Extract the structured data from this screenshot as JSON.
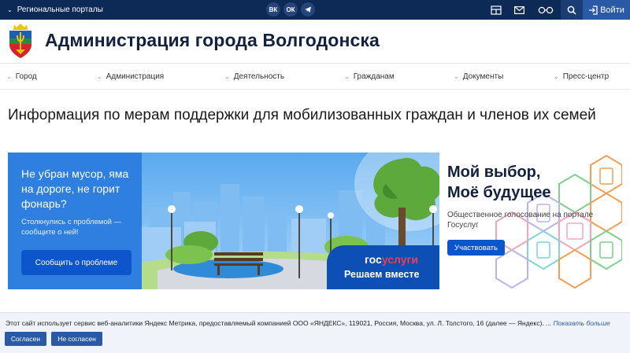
{
  "topbar": {
    "regional_label": "Региональные порталы",
    "socials": [
      "ВК",
      "ОК",
      "TG"
    ],
    "login_label": "Войти"
  },
  "header": {
    "title": "Администрация города Волгодонска"
  },
  "nav": {
    "items": [
      "Город",
      "Администрация",
      "Деятельность",
      "Гражданам",
      "Документы",
      "Пресс-центр"
    ]
  },
  "page": {
    "title": "Информация по мерам поддержки для мобилизованных граждан и членов их семей"
  },
  "banner": {
    "left_headline": "Не убран мусор, яма на дороге, не горит фонарь?",
    "left_sub": "Столкнулись с проблемой — сообщите о ней!",
    "left_button": "Сообщить о проблеме",
    "gos_logo_a": "гос",
    "gos_logo_b": "услуги",
    "gos_sub": "Решаем вместе",
    "right_headline_1": "Мой выбор,",
    "right_headline_2": "Моё будущее",
    "right_sub": "Общественное голосование на портале Госуслуг",
    "right_button": "Участвовать"
  },
  "cookie": {
    "text": "Этот сайт использует сервис веб-аналитики Яндекс Метрика, предоставляемый компанией ООО «ЯНДЕКС», 119021, Россия, Москва, ул. Л. Толстого, 16 (далее — Яндекс).",
    "more": "... Показать больше",
    "accept": "Согласен",
    "decline": "Не согласен"
  },
  "colors": {
    "topbar": "#0d2a57",
    "accent": "#2a5aa6",
    "banner_blue": "#2f7fe0"
  }
}
